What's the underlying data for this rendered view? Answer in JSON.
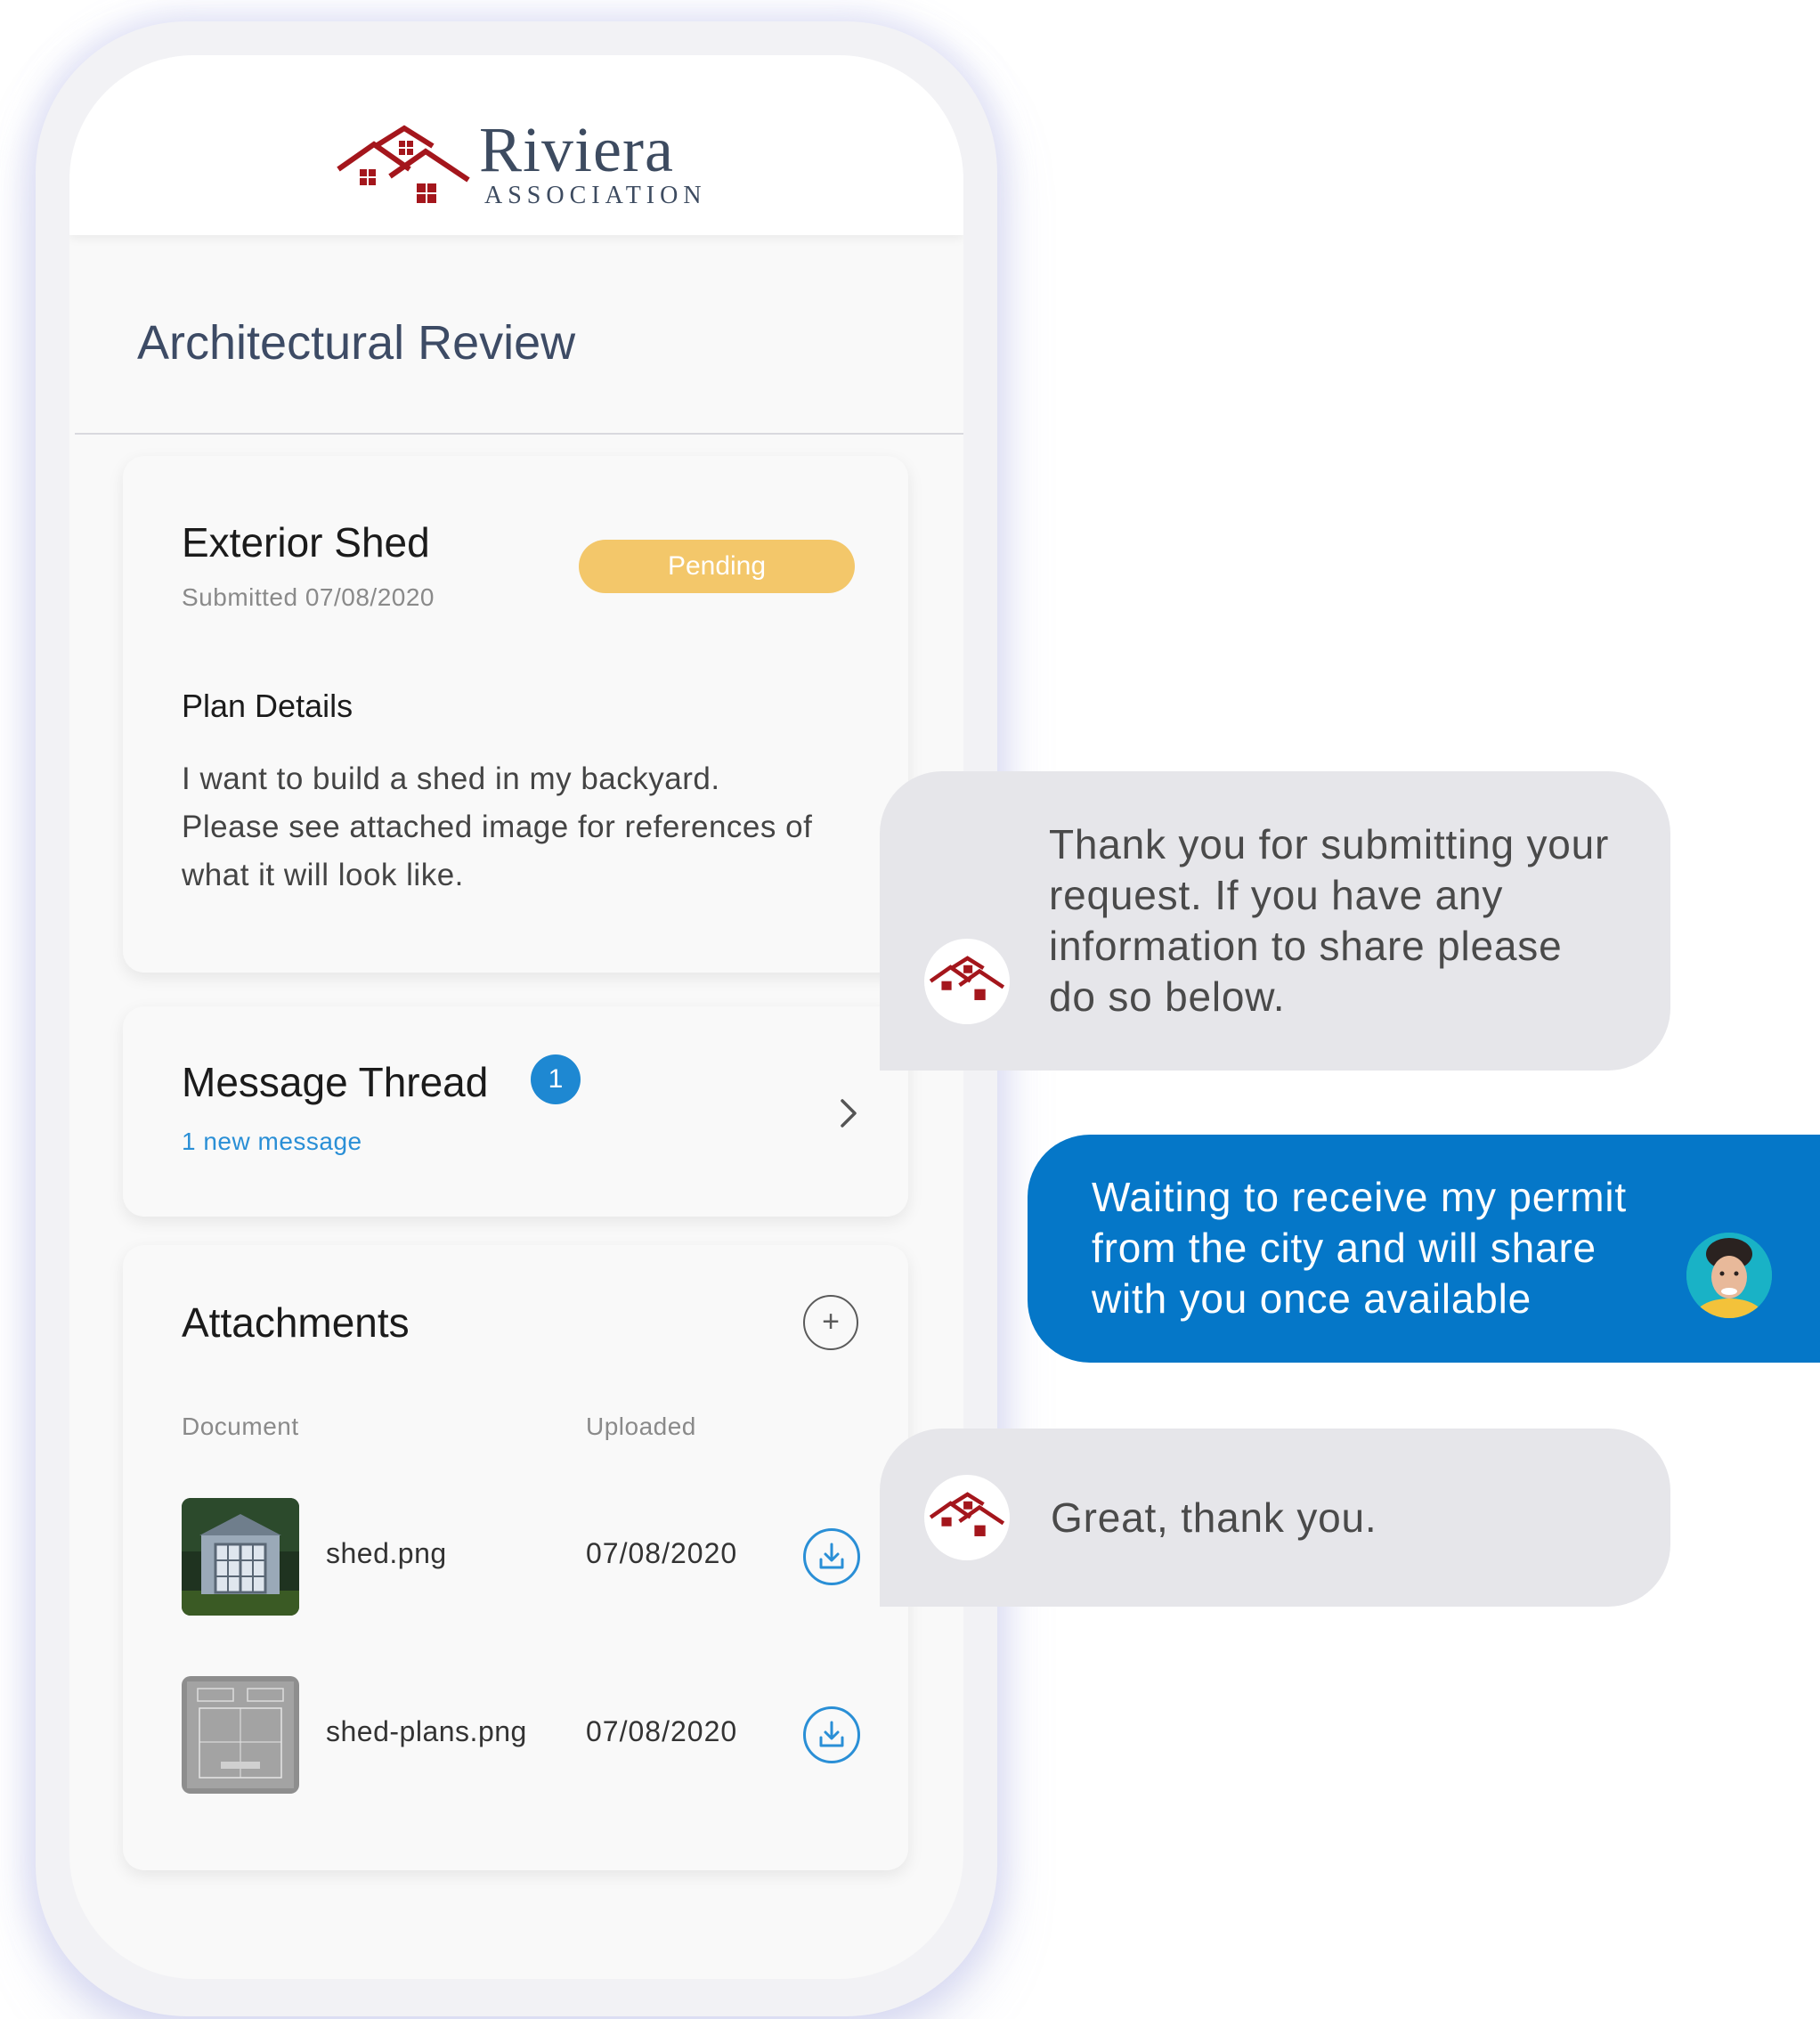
{
  "brand": {
    "name": "Riviera",
    "subtitle": "ASSOCIATION",
    "color": "#a4161c"
  },
  "page": {
    "title": "Architectural Review"
  },
  "request": {
    "title": "Exterior Shed",
    "submitted": "Submitted 07/08/2020",
    "status": "Pending",
    "status_color": "#f3c76a",
    "plan_label": "Plan Details",
    "plan_text": "I want to build a shed in my backyard. Please see attached image for references of what it will look like."
  },
  "thread": {
    "title": "Message Thread",
    "count": "1",
    "subtitle": "1 new message",
    "chevron_icon": "chevron-right-icon"
  },
  "attachments": {
    "title": "Attachments",
    "add_icon": "plus-icon",
    "add_label": "+",
    "columns": {
      "document": "Document",
      "uploaded": "Uploaded"
    },
    "files": [
      {
        "name": "shed.png",
        "date": "07/08/2020"
      },
      {
        "name": "shed-plans.png",
        "date": "07/08/2020"
      }
    ]
  },
  "chat": {
    "accent": "#0577c8",
    "messages": [
      {
        "sender": "association",
        "text": "Thank you for submitting your request. If you have any information to share please do so below."
      },
      {
        "sender": "user",
        "text": "Waiting to receive my permit from the city and will share with you once available"
      },
      {
        "sender": "association",
        "text": "Great, thank you."
      }
    ]
  }
}
